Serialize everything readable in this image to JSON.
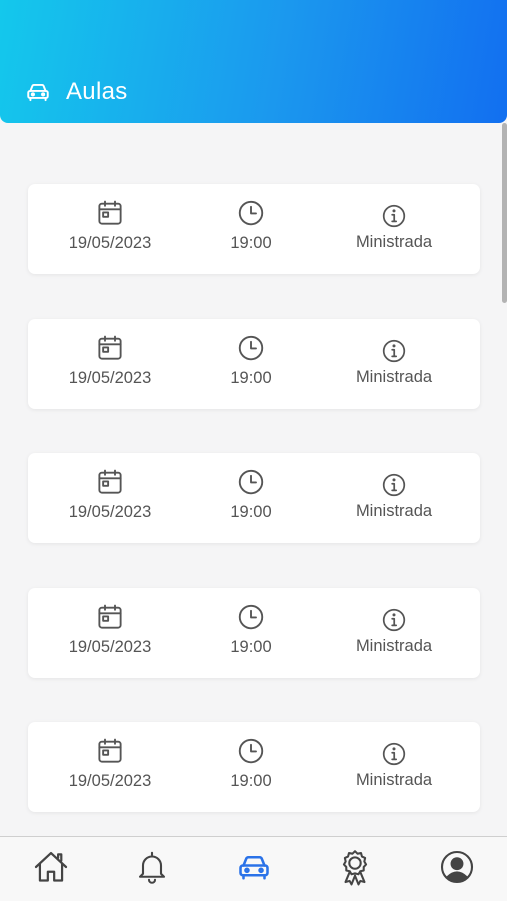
{
  "header": {
    "title": "Aulas",
    "icon": "car-icon",
    "gradient": [
      "#14c8ec",
      "#126ff0"
    ]
  },
  "lessons": [
    {
      "date": "19/05/2023",
      "time": "19:00",
      "status": "Ministrada"
    },
    {
      "date": "19/05/2023",
      "time": "19:00",
      "status": "Ministrada"
    },
    {
      "date": "19/05/2023",
      "time": "19:00",
      "status": "Ministrada"
    },
    {
      "date": "19/05/2023",
      "time": "19:00",
      "status": "Ministrada"
    },
    {
      "date": "19/05/2023",
      "time": "19:00",
      "status": "Ministrada"
    }
  ],
  "icons": {
    "date": "calendar-icon",
    "time": "clock-icon",
    "status": "info-icon"
  },
  "tabbar": {
    "items": [
      {
        "name": "home",
        "icon": "home-icon",
        "active": false
      },
      {
        "name": "notifications",
        "icon": "bell-icon",
        "active": false
      },
      {
        "name": "lessons",
        "icon": "car-icon",
        "active": true
      },
      {
        "name": "achievements",
        "icon": "award-icon",
        "active": false
      },
      {
        "name": "profile",
        "icon": "user-circle-icon",
        "active": false
      }
    ],
    "active_color": "#2a72e8",
    "inactive_color": "#444444"
  }
}
